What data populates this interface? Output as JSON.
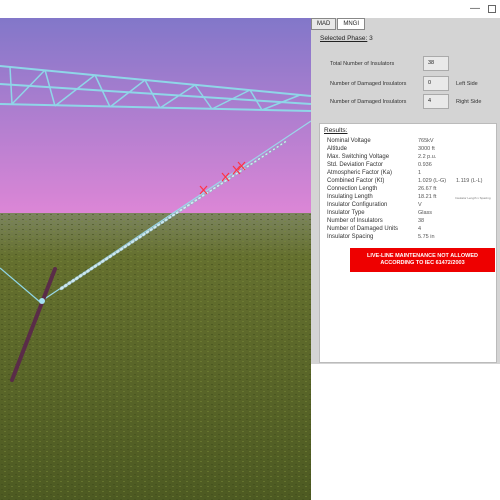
{
  "window": {
    "minimize_glyph": "—",
    "maximize_icon": "maximize-icon"
  },
  "tabs": [
    {
      "label": "MAD",
      "active": false
    },
    {
      "label": "MNGI",
      "active": true
    }
  ],
  "phase": {
    "label": "Selected Phase:",
    "value": "3"
  },
  "form": {
    "total_label": "Total Number of Insulators",
    "total_value": "38",
    "damaged_left_label": "Number of Damaged Insulators",
    "damaged_left_value": "0",
    "left_side": "Left Side",
    "damaged_right_label": "Number of Damaged Insulators",
    "damaged_right_value": "4",
    "right_side": "Right Side"
  },
  "results": {
    "title": "Results:",
    "rows": [
      {
        "label": "Nominal Voltage",
        "value": "765kV"
      },
      {
        "label": "Altitude",
        "value": "3000 ft"
      },
      {
        "label": "Max. Switching Voltage",
        "value": "2.2 p.u."
      },
      {
        "label": "Std. Deviation Factor",
        "value": "0.936"
      },
      {
        "label": "Atmospheric Factor (Ka)",
        "value": "1"
      },
      {
        "label": "Combined Factor (Kt)",
        "value": "1.029 (L-G)",
        "value2": "1.119 (L-L)"
      },
      {
        "label": "Connection Length",
        "value": "26.67 ft"
      },
      {
        "label": "Insulating Length",
        "value": "18.21 ft",
        "note": "Insulator Length x Spacing"
      },
      {
        "label": "Insulator Configuration",
        "value": "V"
      },
      {
        "label": "Insulator Type",
        "value": "Glass"
      },
      {
        "label": "Number of Insulators",
        "value": "38"
      },
      {
        "label": "Number of Damaged Units",
        "value": "4"
      },
      {
        "label": "Insulator Spacing",
        "value": "5.75 in"
      }
    ],
    "warning_line1": "LIVE-LINE MAINTENANCE NOT ALLOWED",
    "warning_line2": "ACCORDING TO IEC 61472/2003"
  },
  "colors": {
    "sky_top": "#8277c9",
    "sky_bottom": "#dc86d6",
    "ground": "#5b6a2e",
    "tower": "#8fd6e8",
    "warning": "#ee0000",
    "panel": "#d4d4d4"
  }
}
